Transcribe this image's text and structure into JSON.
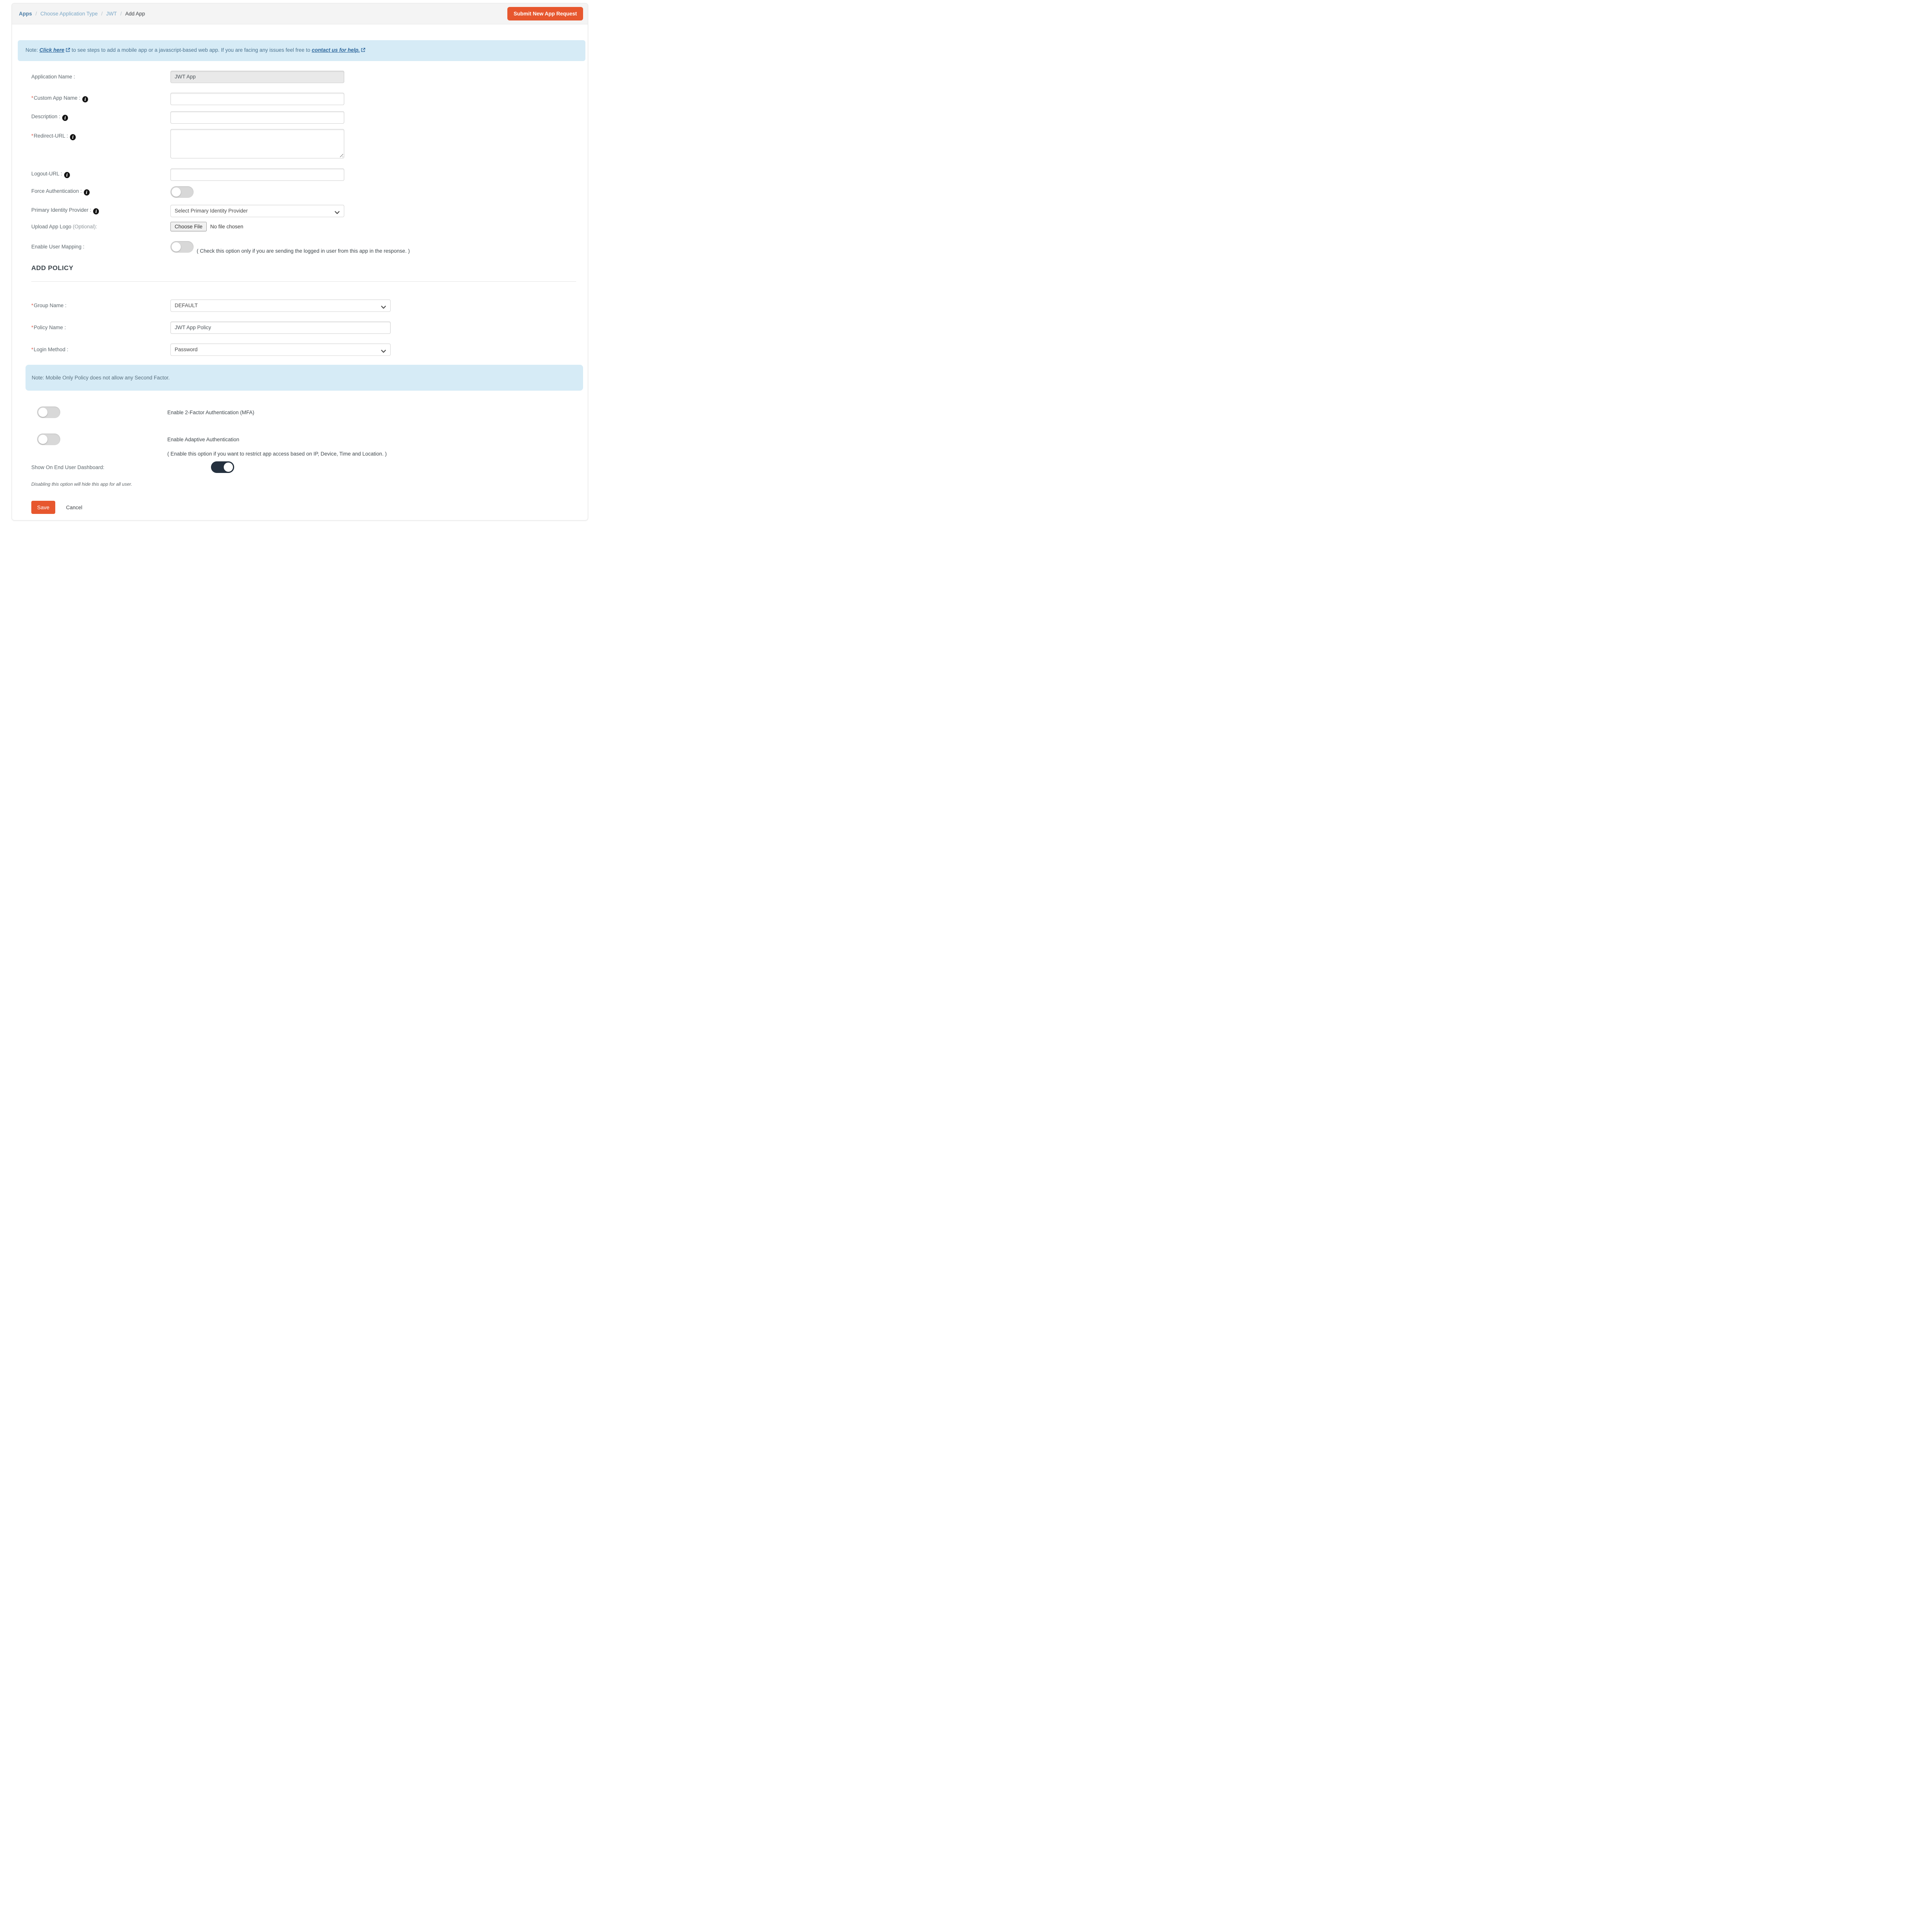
{
  "breadcrumb": {
    "separator": "/",
    "items": [
      {
        "label": "Apps"
      },
      {
        "label": "Choose Application Type"
      },
      {
        "label": "JWT"
      },
      {
        "label": "Add App"
      }
    ]
  },
  "header": {
    "submit_button": "Submit New App Request"
  },
  "icons": {
    "info_glyph": "i",
    "chevron": "chevron-down",
    "external": "box-arrow-up-right"
  },
  "notes": {
    "top": {
      "prefix": "Note: ",
      "link_steps": "Click here",
      "middle": " to see steps to add a mobile app or a javascript-based web app. If you are facing any issues feel free to ",
      "link_contact": "contact us for help."
    },
    "policy": "Note: Mobile Only Policy does not allow any Second Factor."
  },
  "form": {
    "application_name": {
      "label": "Application Name :",
      "value": "JWT App"
    },
    "custom_app_name": {
      "required": "*",
      "label": "Custom App Name :"
    },
    "description": {
      "label": "Description :"
    },
    "redirect_url": {
      "required": "*",
      "label": "Redirect-URL :"
    },
    "logout_url": {
      "label": "Logout-URL :"
    },
    "force_authentication": {
      "label": "Force Authentication :",
      "state": "off"
    },
    "primary_idp": {
      "label": "Primary Identity Provider :",
      "value": "Select Primary Identity Provider"
    },
    "upload_logo": {
      "label": "Upload App Logo ",
      "optional": "(Optional):",
      "button": "Choose File",
      "status": "No file chosen"
    },
    "user_mapping": {
      "label": "Enable User Mapping :",
      "state": "off",
      "hint": "( Check this option only if you are sending the logged in user from this app in the response. )"
    }
  },
  "policy": {
    "heading": "ADD POLICY",
    "group_name": {
      "required": "*",
      "label": "Group Name :",
      "value": "DEFAULT"
    },
    "policy_name": {
      "required": "*",
      "label": "Policy Name :",
      "value": "JWT App Policy"
    },
    "login_method": {
      "required": "*",
      "label": "Login Method :",
      "value": "Password"
    },
    "mfa": {
      "label": "Enable 2-Factor Authentication (MFA)",
      "state": "off"
    },
    "adaptive": {
      "label": "Enable Adaptive Authentication",
      "state": "off",
      "hint": "( Enable this option if you want to restrict app access based on IP, Device, Time and Location. )"
    },
    "show_dashboard": {
      "label": "Show On End User Dashboard:",
      "state": "on",
      "note": "Disabling this option will hide this app for all user."
    }
  },
  "actions": {
    "save": "Save",
    "cancel": "Cancel"
  },
  "colors": {
    "accent_orange": "#E7572E",
    "note_bg": "#D6EBF6",
    "link_blue": "#2C669C",
    "toggle_on_navy": "#25313F",
    "breadcrumb_active": "#4A7CA6"
  }
}
